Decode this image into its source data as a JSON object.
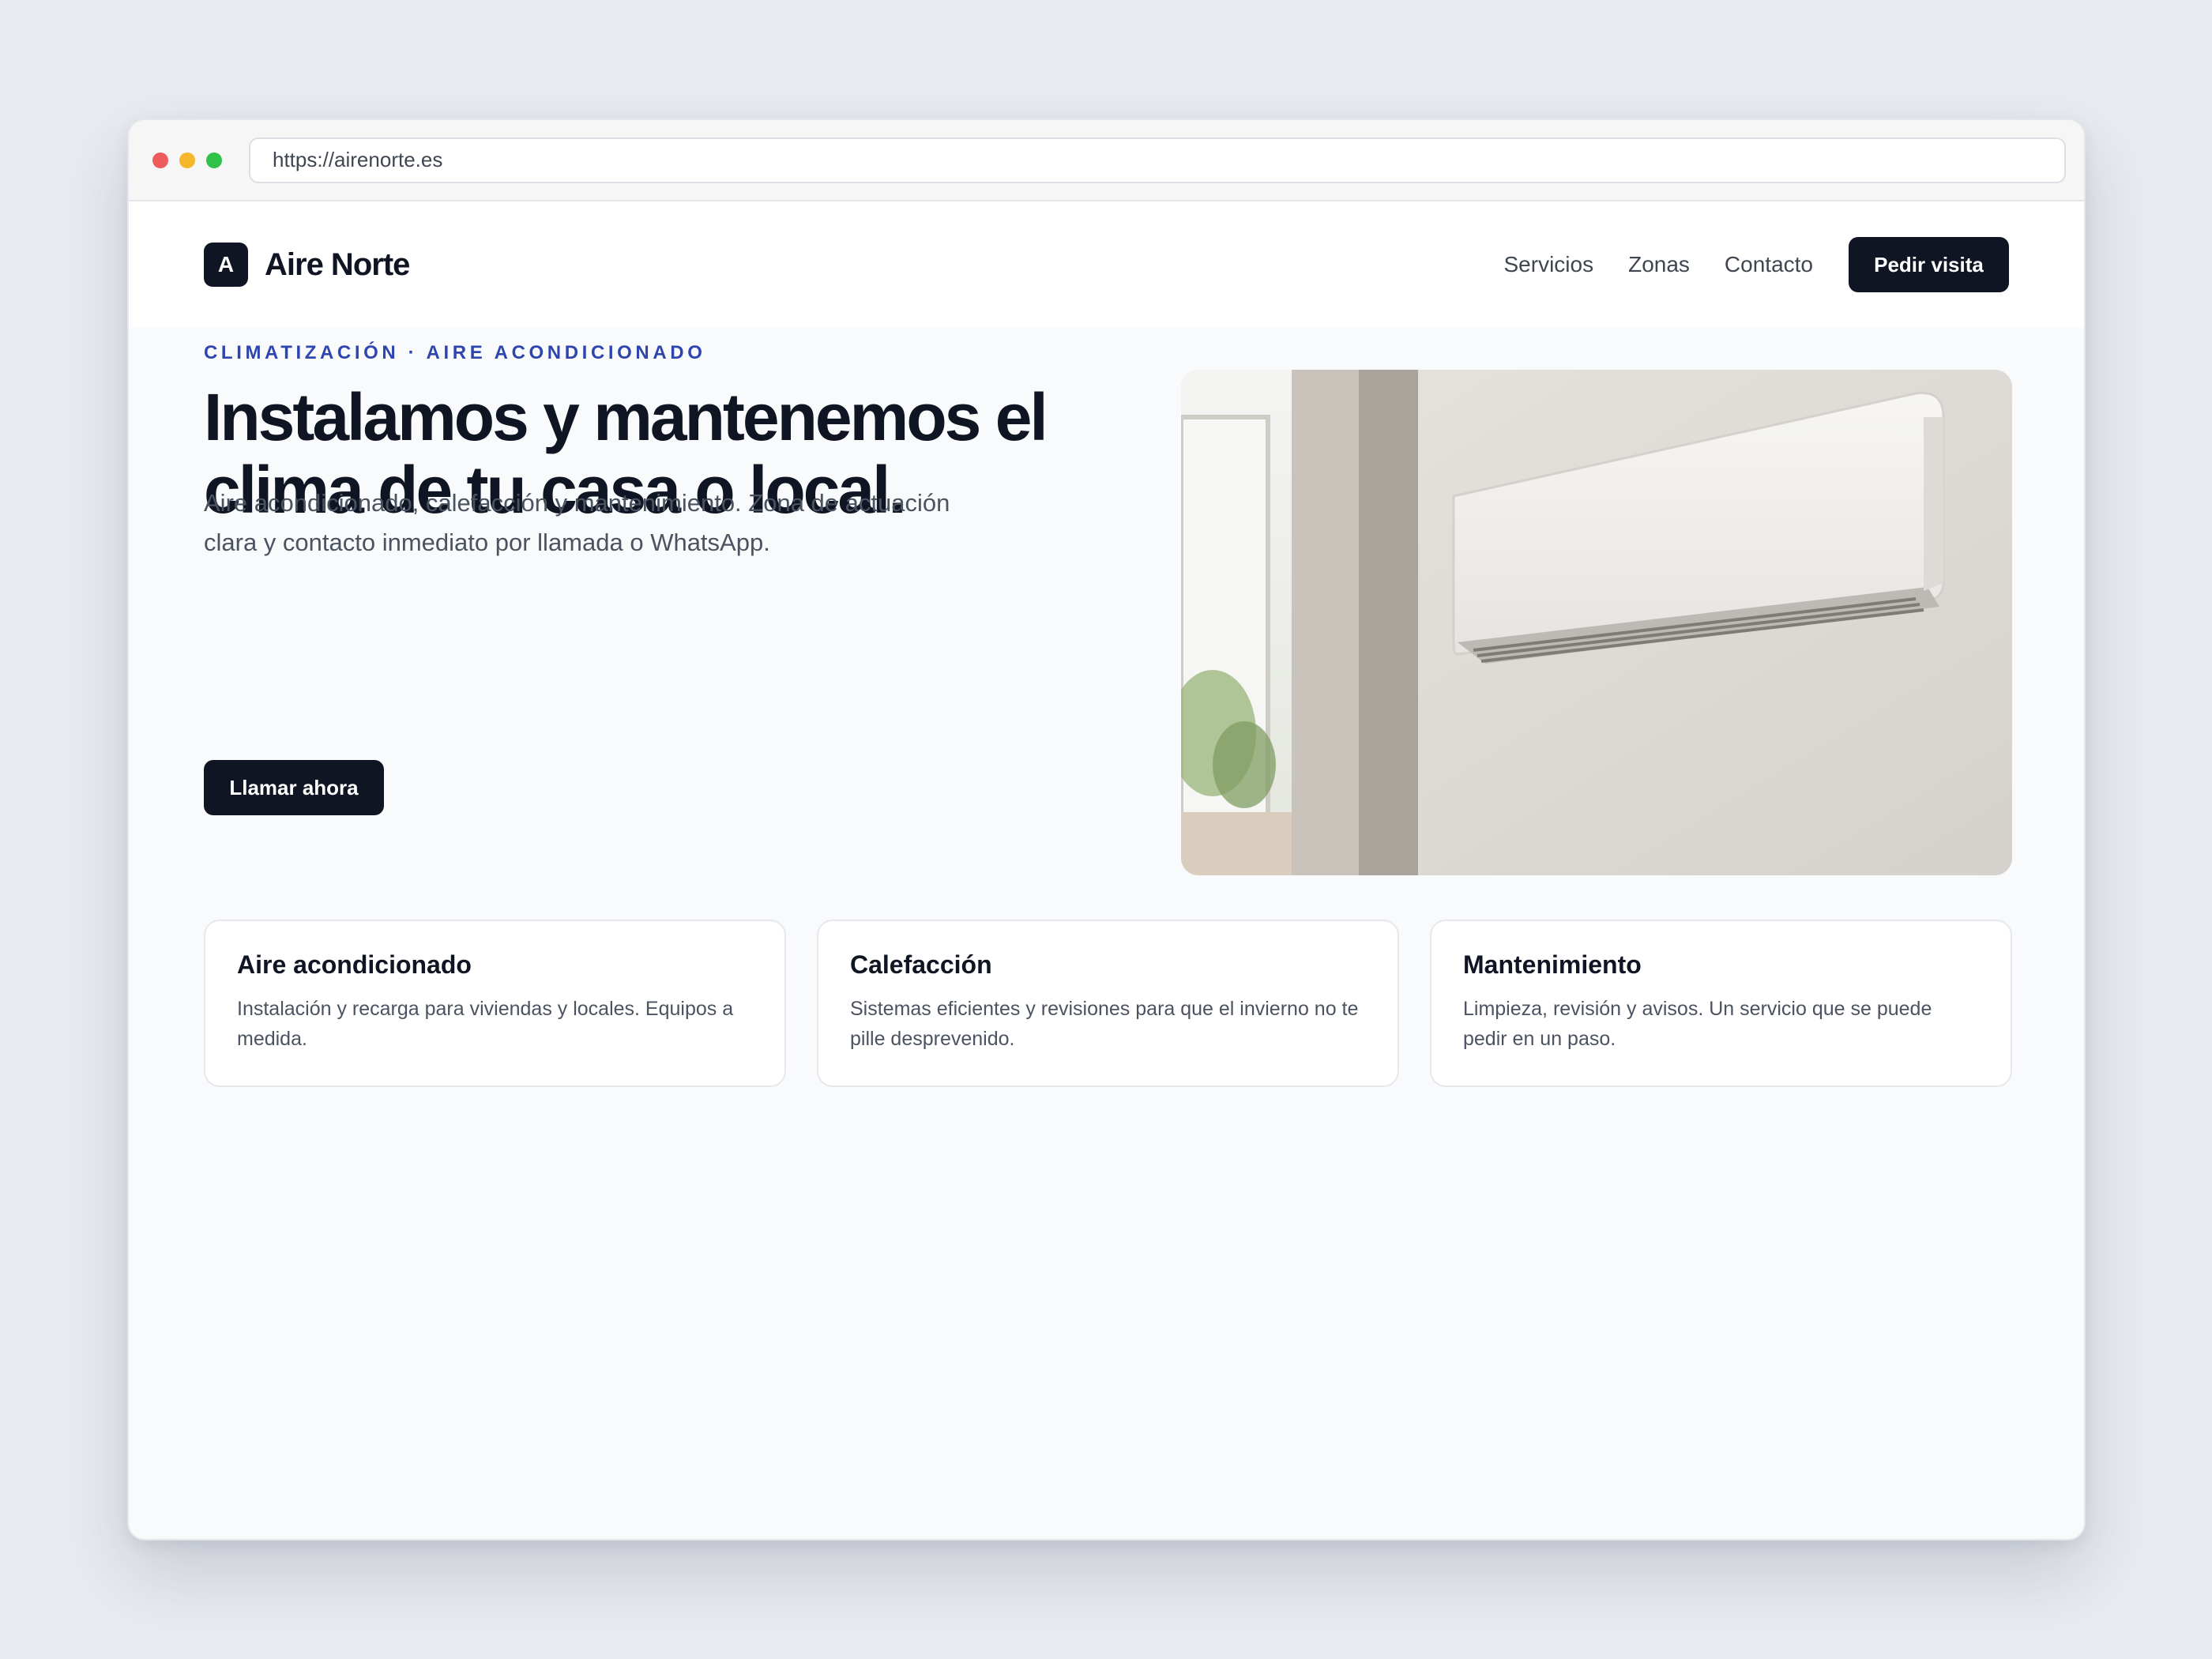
{
  "browser": {
    "url": "https://airenorte.es",
    "controls": {
      "close_color": "#ef5b5b",
      "minimize_color": "#f5b729",
      "maximize_color": "#2fc148"
    }
  },
  "navbar": {
    "logo_letter": "A",
    "brand": "Aire Norte",
    "links": [
      "Servicios",
      "Zonas",
      "Contacto"
    ],
    "cta": "Pedir visita"
  },
  "hero": {
    "eyebrow": "CLIMATIZACIÓN · AIRE ACONDICIONADO",
    "headline": "Instalamos y mantenemos el clima de tu casa o local.",
    "lead": "Aire acondicionado, calefacción y mantenimiento. Zona de actuación clara y contacto inmediato por llamada o WhatsApp.",
    "cta": "Llamar ahora",
    "image": "wall-mounted-air-conditioner-photo"
  },
  "services": [
    {
      "title": "Aire acondicionado",
      "text": "Instalación y recarga para viviendas y locales. Equipos a medida."
    },
    {
      "title": "Calefacción",
      "text": "Sistemas eficientes y revisiones para que el invierno no te pille desprevenido."
    },
    {
      "title": "Mantenimiento",
      "text": "Limpieza, revisión y avisos. Un servicio que se puede pedir en un paso."
    }
  ],
  "colors": {
    "accent": "#2f45ae",
    "dark": "#0f1523",
    "page_bg": "#f9fafc"
  }
}
